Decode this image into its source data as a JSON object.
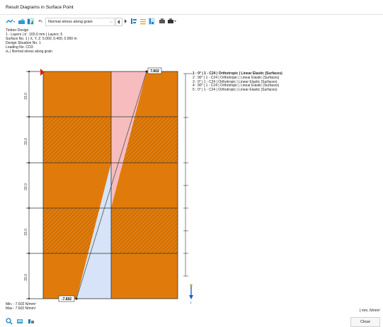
{
  "window": {
    "title": "Result Diagrams in Surface Point"
  },
  "toolbar": {
    "sigma_symbol": "σₓ",
    "dropdown_value": "Normal stress along grain",
    "icons": [
      "result-type-icon",
      "surface-point-icon",
      "diagram-icon",
      "chevron-icon",
      "prev-arrow-icon",
      "next-arrow-icon",
      "layers-icon",
      "fill-lines-icon",
      "bars-icon",
      "print-icon",
      "printer-icon"
    ]
  },
  "info": {
    "line1": "Timber Design",
    "line2": "1 - Layers | d : 165.0 mm | Layers: 5",
    "line3": "Surface No. 1 | X, Y, Z: 5.000, 0.400, 0.000 m",
    "line4": "Design Situation No. 1",
    "line5": "Loading No. CO3",
    "line6": "σₓ | Normal stress along grain"
  },
  "diagram": {
    "top_value": "7.602",
    "bottom_value": "-7.602",
    "layer_thickness_label": "33.0",
    "layers": [
      {
        "label": "1 :   0° | 1 - C24 | Orthotropic | Linear Elastic (Surfaces)"
      },
      {
        "label": "2 :  90° | 1 - C24 | Orthotropic | Linear Elastic (Surfaces)"
      },
      {
        "label": "3 :   0° | 1 - C24 | Orthotropic | Linear Elastic (Surfaces)"
      },
      {
        "label": "4 :  90° | 1 - C24 | Orthotropic | Linear Elastic (Surfaces)"
      },
      {
        "label": "5 :   0° | 1 - C24 | Orthotropic | Linear Elastic (Surfaces)"
      }
    ],
    "axis_label": "z",
    "colors": {
      "layer": "#e07b0b",
      "positive": "#f6bcbe",
      "negative": "#d6e3f8",
      "marker": "#e81919",
      "axis": "#d6a516"
    }
  },
  "summary": {
    "min": "Min.: -7.602 N/mm²",
    "max": "Max.: 7.602 N/mm²",
    "units": "[ mm, N/mm²"
  },
  "bottom": {
    "close_label": "Close",
    "icons": [
      "search-icon",
      "table-icon",
      "settings-icon"
    ]
  }
}
